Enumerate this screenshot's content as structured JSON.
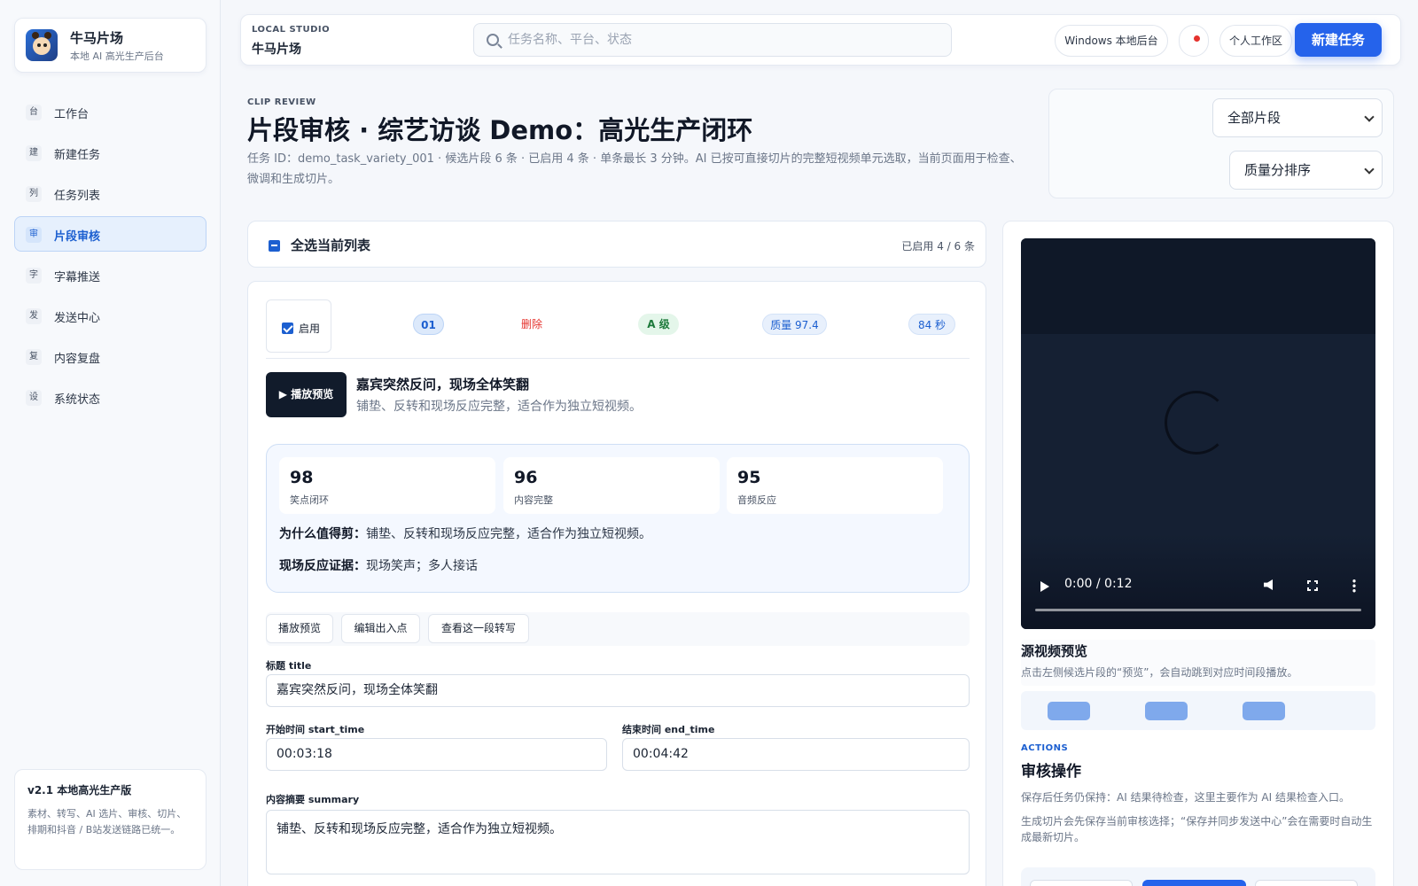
{
  "brand": {
    "name": "牛马片场",
    "subtitle": "本地 AI 高光生产后台"
  },
  "nav": [
    {
      "icon": "台",
      "label": "工作台"
    },
    {
      "icon": "建",
      "label": "新建任务"
    },
    {
      "icon": "列",
      "label": "任务列表"
    },
    {
      "icon": "审",
      "label": "片段审核"
    },
    {
      "icon": "字",
      "label": "字幕推送"
    },
    {
      "icon": "发",
      "label": "发送中心"
    },
    {
      "icon": "复",
      "label": "内容复盘"
    },
    {
      "icon": "设",
      "label": "系统状态"
    }
  ],
  "version": {
    "title": "v2.1 本地高光生产版",
    "desc": "素材、转写、AI 选片、审核、切片、排期和抖音 / B站发送链路已统一。"
  },
  "topbar": {
    "tag": "LOCAL STUDIO",
    "name": "牛马片场",
    "search_placeholder": "任务名称、平台、状态",
    "backend": "Windows 本地后台",
    "workspace": "个人工作区",
    "new_task": "新建任务"
  },
  "page": {
    "eyebrow": "CLIP REVIEW",
    "title": "片段审核 · 综艺访谈 Demo：高光生产闭环",
    "desc": "任务 ID：demo_task_variety_001 · 候选片段 6 条 · 已启用 4 条 · 单条最长 3 分钟。AI 已按可直接切片的完整短视频单元选取，当前页面用于检查、微调和生成切片。"
  },
  "filters": {
    "segment": "全部片段",
    "sort": "质量分排序"
  },
  "select_all": {
    "label": "全选当前列表",
    "count": "已启用 4 / 6 条"
  },
  "clip": {
    "enabled_label": "启用",
    "index": "01",
    "delete": "删除",
    "grade": "A 级",
    "quality": "质量 97.4",
    "duration": "84 秒",
    "play": "播放预览",
    "title": "嘉宾突然反问，现场全体笑翻",
    "summary_line": "铺垫、反转和现场反应完整，适合作为独立短视频。",
    "scores": [
      {
        "value": "98",
        "name": "笑点闭环"
      },
      {
        "value": "96",
        "name": "内容完整"
      },
      {
        "value": "95",
        "name": "音频反应"
      }
    ],
    "why_label": "为什么值得剪：",
    "why_text": "铺垫、反转和现场反应完整，适合作为独立短视频。",
    "evidence_label": "现场反应证据：",
    "evidence_text": "现场笑声；多人接话",
    "actions": {
      "play": "播放预览",
      "edit": "编辑出入点",
      "transcript": "查看这一段转写"
    },
    "fields": {
      "title_label": "标题 title",
      "title_value": "嘉宾突然反问，现场全体笑翻",
      "start_label": "开始时间 start_time",
      "start_value": "00:03:18",
      "end_label": "结束时间 end_time",
      "end_value": "00:04:42",
      "summary_label": "内容摘要 summary",
      "summary_value": "铺垫、反转和现场反应完整，适合作为独立短视频。"
    }
  },
  "preview": {
    "time": "0:00 / 0:12",
    "title": "源视频预览",
    "desc": "点击左侧候选片段的“预览”，会自动跳到对应时间段播放。"
  },
  "actions_panel": {
    "eyebrow": "ACTIONS",
    "title": "审核操作",
    "desc1": "保存后任务仍保持：AI 结果待检查，这里主要作为 AI 结果检查入口。",
    "desc2": "生成切片会先保存当前审核选择；“保存并同步发送中心”会在需要时自动生成最新切片。"
  },
  "colors": {
    "accent": "#2563eb",
    "danger": "#e5322d",
    "grade_bg": "#e4f6ea",
    "grade_fg": "#1d7a3b"
  }
}
